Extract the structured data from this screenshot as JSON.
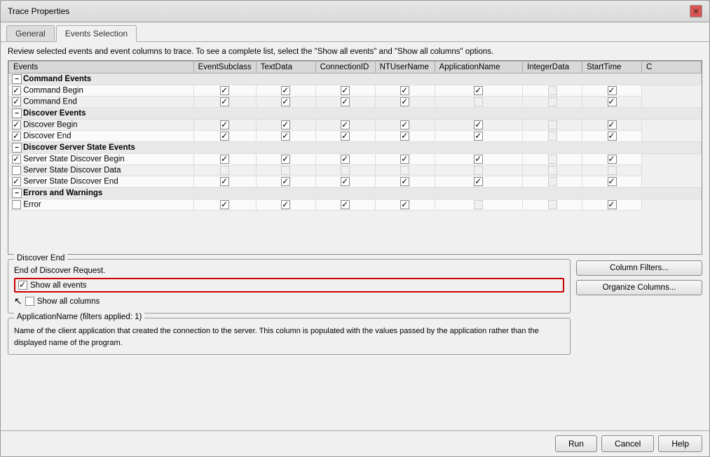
{
  "window": {
    "title": "Trace Properties",
    "close_label": "✕"
  },
  "tabs": [
    {
      "id": "general",
      "label": "General",
      "active": false
    },
    {
      "id": "events-selection",
      "label": "Events Selection",
      "active": true
    }
  ],
  "instruction": "Review selected events and event columns to trace. To see a complete list, select the \"Show all events\" and \"Show all columns\" options.",
  "table": {
    "columns": [
      "Events",
      "EventSubclass",
      "TextData",
      "ConnectionID",
      "NTUserName",
      "ApplicationName",
      "IntegerData",
      "StartTime",
      "C"
    ],
    "rows": [
      {
        "type": "category",
        "expand": "−",
        "name": "Command Events"
      },
      {
        "type": "event",
        "name": "Command Begin",
        "checked": true,
        "cols": [
          true,
          true,
          true,
          true,
          true,
          false,
          true
        ]
      },
      {
        "type": "event",
        "name": "Command End",
        "checked": true,
        "cols": [
          true,
          true,
          true,
          true,
          false,
          false,
          true
        ]
      },
      {
        "type": "category",
        "expand": "−",
        "name": "Discover Events"
      },
      {
        "type": "event",
        "name": "Discover Begin",
        "checked": true,
        "cols": [
          true,
          true,
          true,
          true,
          true,
          false,
          true
        ]
      },
      {
        "type": "event",
        "name": "Discover End",
        "checked": true,
        "cols": [
          true,
          true,
          true,
          true,
          true,
          false,
          true
        ]
      },
      {
        "type": "category",
        "expand": "−",
        "name": "Discover Server State Events"
      },
      {
        "type": "event",
        "name": "Server State Discover Begin",
        "checked": true,
        "cols": [
          true,
          true,
          true,
          true,
          true,
          false,
          true
        ]
      },
      {
        "type": "event",
        "name": "Server State Discover Data",
        "checked": false,
        "cols": [
          false,
          false,
          false,
          false,
          false,
          false,
          false
        ]
      },
      {
        "type": "event",
        "name": "Server State Discover End",
        "checked": true,
        "cols": [
          true,
          true,
          true,
          true,
          true,
          false,
          true
        ]
      },
      {
        "type": "category",
        "expand": "−",
        "name": "Errors and Warnings"
      },
      {
        "type": "event",
        "name": "Error",
        "checked": false,
        "cols": [
          true,
          true,
          true,
          true,
          false,
          false,
          true
        ]
      }
    ]
  },
  "discover_end_box": {
    "title": "Discover End",
    "description": "End of Discover Request."
  },
  "show_options": {
    "show_all_events_label": "Show all events",
    "show_all_columns_label": "Show all columns",
    "show_all_events_checked": true,
    "show_all_columns_checked": false
  },
  "appname_box": {
    "title": "ApplicationName (filters applied: 1)",
    "description": "Name of the client application that created the connection to the server. This column is populated with the values passed by the application rather than the displayed name of the program."
  },
  "right_buttons": [
    {
      "id": "column-filters",
      "label": "Column Filters..."
    },
    {
      "id": "organize-columns",
      "label": "Organize Columns..."
    }
  ],
  "footer_buttons": [
    {
      "id": "run",
      "label": "Run"
    },
    {
      "id": "cancel",
      "label": "Cancel"
    },
    {
      "id": "help",
      "label": "Help"
    }
  ]
}
